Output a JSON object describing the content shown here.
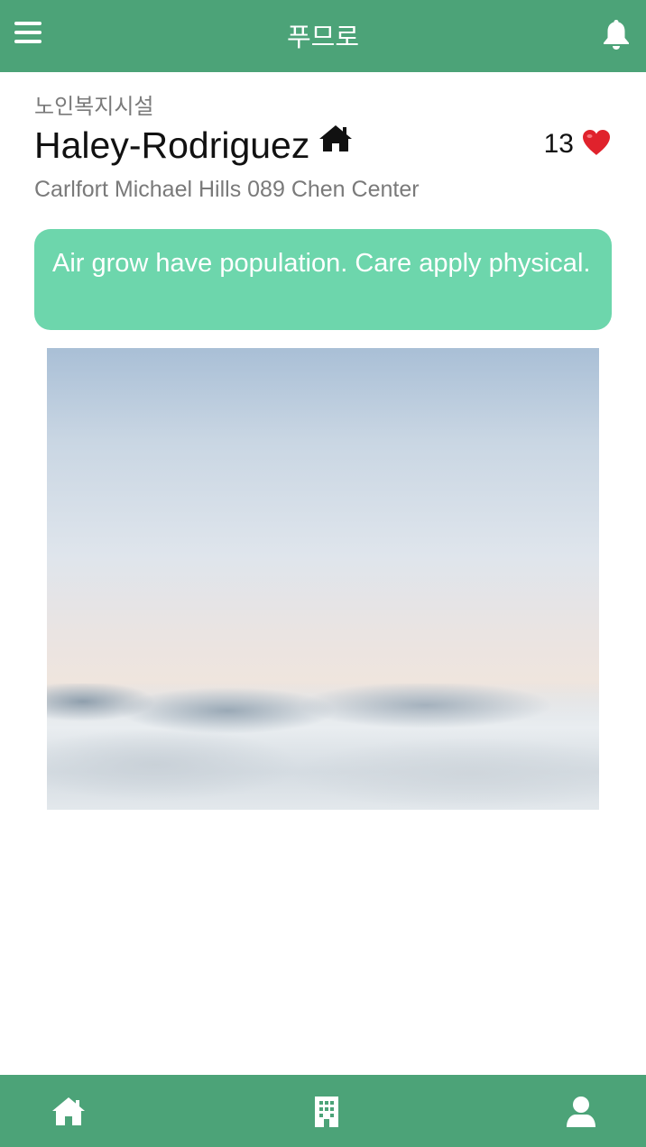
{
  "header": {
    "title": "푸므로",
    "menu_icon": "hamburger-menu-icon",
    "bell_icon": "bell-icon"
  },
  "facility": {
    "category": "노인복지시설",
    "name": "Haley-Rodriguez",
    "name_icon": "house-icon",
    "likes_count": "13",
    "likes_icon": "heart-icon",
    "address": "Carlfort Michael Hills 089 Chen Center"
  },
  "message": {
    "text": "Air grow have population. Care apply physical."
  },
  "bottom_nav": {
    "items": [
      {
        "icon": "home-icon"
      },
      {
        "icon": "building-icon"
      },
      {
        "icon": "user-icon"
      }
    ]
  },
  "colors": {
    "brand_green": "#4ca378",
    "bubble_green": "#6dd6ac",
    "heart_red": "#e0222c"
  }
}
